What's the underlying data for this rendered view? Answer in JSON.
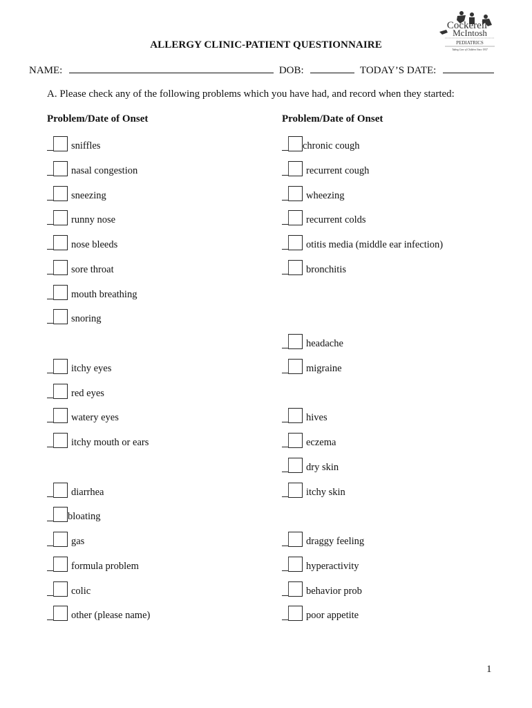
{
  "logo": {
    "name_line1": "Cockerell",
    "name_line2": "McIntosh",
    "department": "PEDIATRICS",
    "tagline": "Taking Care of Children Since 1957",
    "icon": "children-silhouettes-icon"
  },
  "title": "ALLERGY CLINIC-PATIENT QUESTIONNAIRE",
  "id_fields": {
    "name_label": "NAME:",
    "name_value": "",
    "dob_label": "DOB:",
    "dob_value": "",
    "date_label": "TODAY’S DATE:",
    "date_value": ""
  },
  "section_a": {
    "instruction": "A.  Please check any of the following problems which you have had, and record when they started:",
    "left_header": "Problem/Date of Onset",
    "right_header": "Problem/Date of Onset",
    "left_items": [
      {
        "row": 0,
        "label": "sniffles",
        "checked": false
      },
      {
        "row": 1,
        "label": "nasal congestion",
        "checked": false
      },
      {
        "row": 2,
        "label": "sneezing",
        "checked": false
      },
      {
        "row": 3,
        "label": "runny nose",
        "checked": false
      },
      {
        "row": 4,
        "label": "nose bleeds",
        "checked": false
      },
      {
        "row": 5,
        "label": "sore throat",
        "checked": false
      },
      {
        "row": 6,
        "label": "mouth breathing",
        "checked": false
      },
      {
        "row": 7,
        "label": "snoring",
        "checked": false
      },
      {
        "row": 9,
        "label": "itchy eyes",
        "checked": false
      },
      {
        "row": 10,
        "label": "red eyes",
        "checked": false
      },
      {
        "row": 11,
        "label": "watery eyes",
        "checked": false
      },
      {
        "row": 12,
        "label": "itchy mouth or ears",
        "checked": false
      },
      {
        "row": 14,
        "label": "diarrhea",
        "checked": false
      },
      {
        "row": 15,
        "label": "bloating",
        "checked": false
      },
      {
        "row": 16,
        "label": "gas",
        "checked": false
      },
      {
        "row": 17,
        "label": "formula problem",
        "checked": false
      },
      {
        "row": 18,
        "label": "colic",
        "checked": false
      },
      {
        "row": 19,
        "label": "other (please name)",
        "checked": false
      }
    ],
    "right_items": [
      {
        "row": 0,
        "label": "chronic cough",
        "checked": false
      },
      {
        "row": 1,
        "label": "recurrent cough",
        "checked": false
      },
      {
        "row": 2,
        "label": "wheezing",
        "checked": false
      },
      {
        "row": 3,
        "label": "recurrent colds",
        "checked": false
      },
      {
        "row": 4,
        "label": "otitis media (middle ear infection)",
        "checked": false
      },
      {
        "row": 5,
        "label": "bronchitis",
        "checked": false
      },
      {
        "row": 8,
        "label": "headache",
        "checked": false
      },
      {
        "row": 9,
        "label": "migraine",
        "checked": false
      },
      {
        "row": 11,
        "label": "hives",
        "checked": false
      },
      {
        "row": 12,
        "label": "eczema",
        "checked": false
      },
      {
        "row": 13,
        "label": "dry skin",
        "checked": false
      },
      {
        "row": 14,
        "label": "itchy skin",
        "checked": false
      },
      {
        "row": 16,
        "label": "draggy feeling",
        "checked": false
      },
      {
        "row": 17,
        "label": "hyperactivity",
        "checked": false
      },
      {
        "row": 18,
        "label": "behavior prob",
        "checked": false
      },
      {
        "row": 19,
        "label": "poor appetite",
        "checked": false
      }
    ]
  },
  "page_number": "1"
}
